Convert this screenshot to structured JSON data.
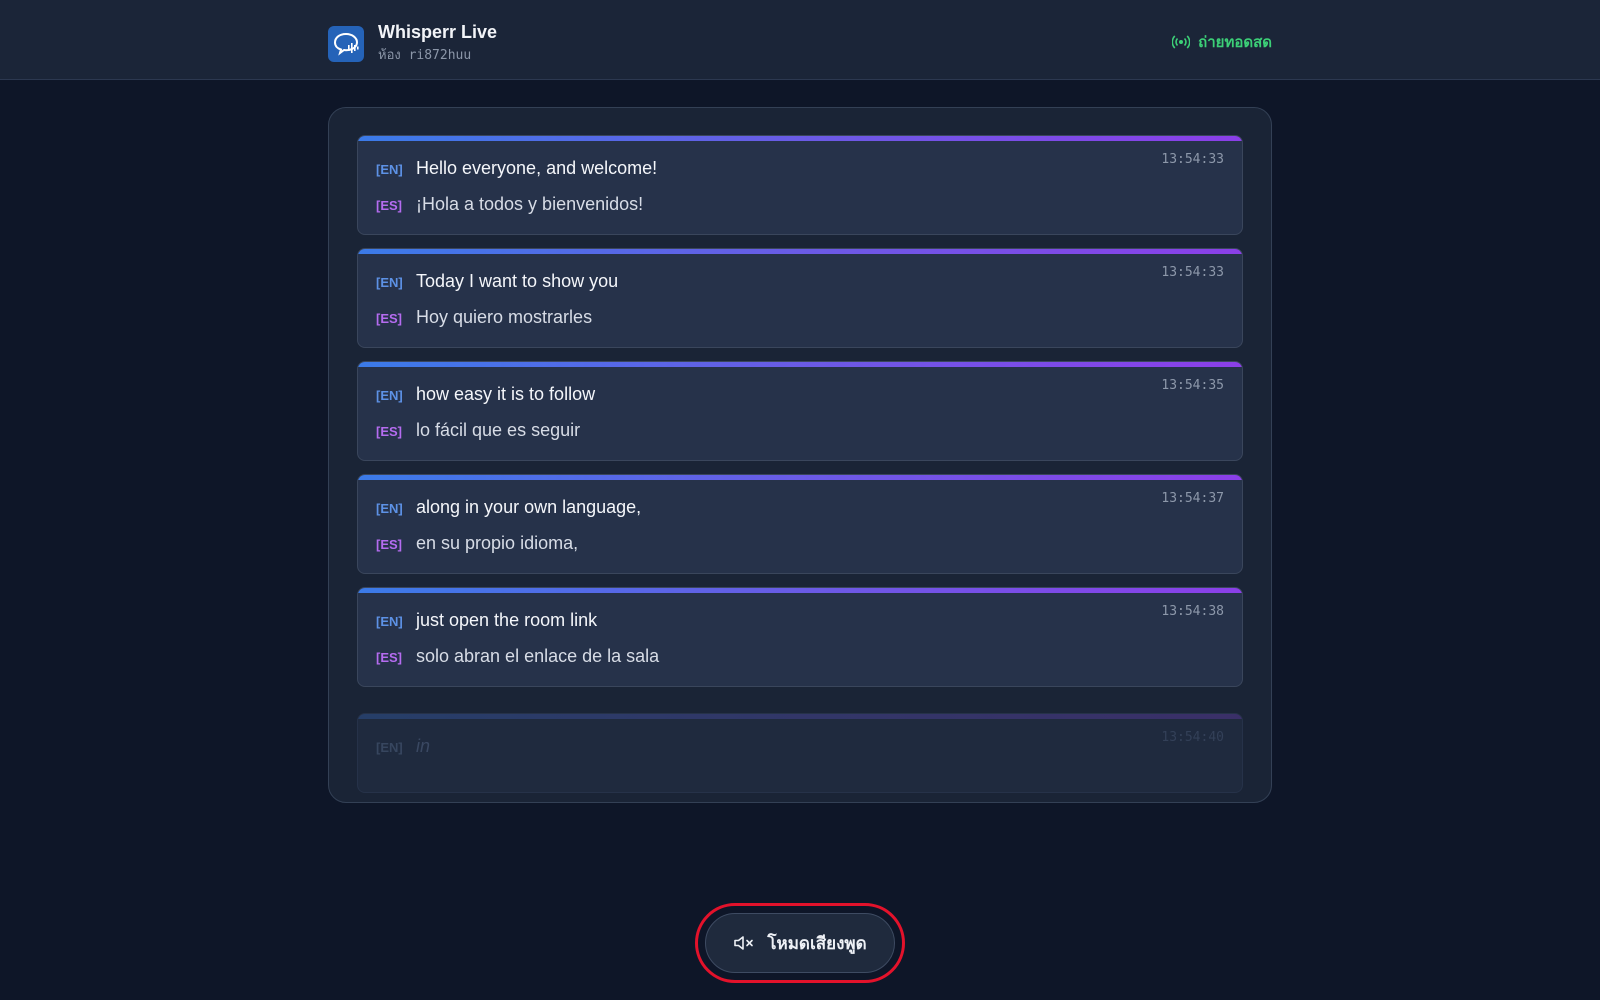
{
  "header": {
    "app_title": "Whisperr Live",
    "room_prefix": "ห้อง",
    "room_code": "ri872huu",
    "live_label": "ถ่ายทอดสด"
  },
  "colors": {
    "accent_blue": "#3b7be8",
    "accent_purple": "#8b3fe8",
    "live_green": "#3ccf77",
    "highlight_red": "#e3122b"
  },
  "transcript": [
    {
      "time": "13:54:33",
      "en_tag": "[EN]",
      "en": "Hello everyone, and welcome!",
      "es_tag": "[ES]",
      "es": "¡Hola a todos y bienvenidos!"
    },
    {
      "time": "13:54:33",
      "en_tag": "[EN]",
      "en": "Today I want to show you",
      "es_tag": "[ES]",
      "es": "Hoy quiero mostrarles"
    },
    {
      "time": "13:54:35",
      "en_tag": "[EN]",
      "en": "how easy it is to follow",
      "es_tag": "[ES]",
      "es": "lo fácil que es seguir"
    },
    {
      "time": "13:54:37",
      "en_tag": "[EN]",
      "en": "along in your own language,",
      "es_tag": "[ES]",
      "es": "en su propio idioma,"
    },
    {
      "time": "13:54:38",
      "en_tag": "[EN]",
      "en": "just open the room link",
      "es_tag": "[ES]",
      "es": "solo abran el enlace de la sala"
    }
  ],
  "pending": {
    "time": "13:54:40",
    "en_tag": "[EN]",
    "en": "in"
  },
  "speech_mode": {
    "label": "โหมดเสียงพูด",
    "icon": "speaker-muted-icon"
  }
}
